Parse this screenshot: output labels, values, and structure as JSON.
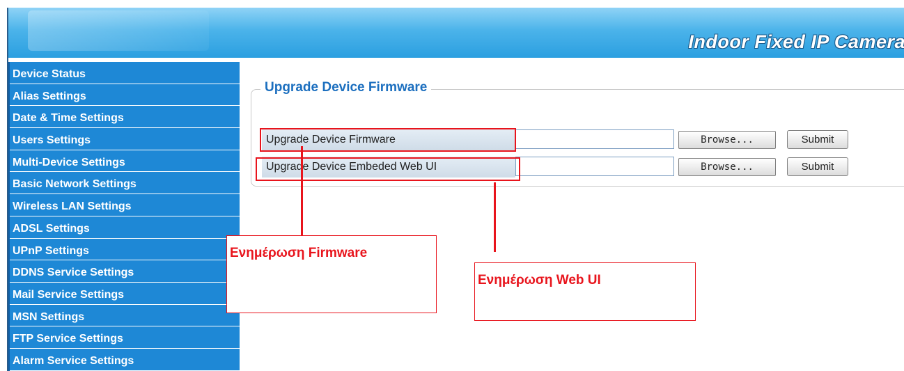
{
  "header": {
    "title": "Indoor Fixed IP Camera"
  },
  "sidebar": {
    "items": [
      {
        "label": "Device Status"
      },
      {
        "label": "Alias Settings"
      },
      {
        "label": "Date & Time Settings"
      },
      {
        "label": "Users Settings"
      },
      {
        "label": "Multi-Device Settings"
      },
      {
        "label": "Basic Network Settings"
      },
      {
        "label": "Wireless LAN Settings"
      },
      {
        "label": "ADSL Settings"
      },
      {
        "label": "UPnP Settings"
      },
      {
        "label": "DDNS Service Settings"
      },
      {
        "label": "Mail Service Settings"
      },
      {
        "label": "MSN Settings"
      },
      {
        "label": "FTP Service Settings"
      },
      {
        "label": "Alarm Service Settings"
      }
    ]
  },
  "main": {
    "legend": "Upgrade Device Firmware",
    "rows": [
      {
        "label": "Upgrade Device Firmware",
        "browse_label": "Browse...",
        "submit_label": "Submit"
      },
      {
        "label": "Upgrade Device Embeded Web UI",
        "browse_label": "Browse...",
        "submit_label": "Submit"
      }
    ]
  },
  "annotations": {
    "firmware_callout": "Ενημέρωση Firmware",
    "webui_callout": "Ενημέρωση Web UI",
    "color": "#e8141c"
  }
}
